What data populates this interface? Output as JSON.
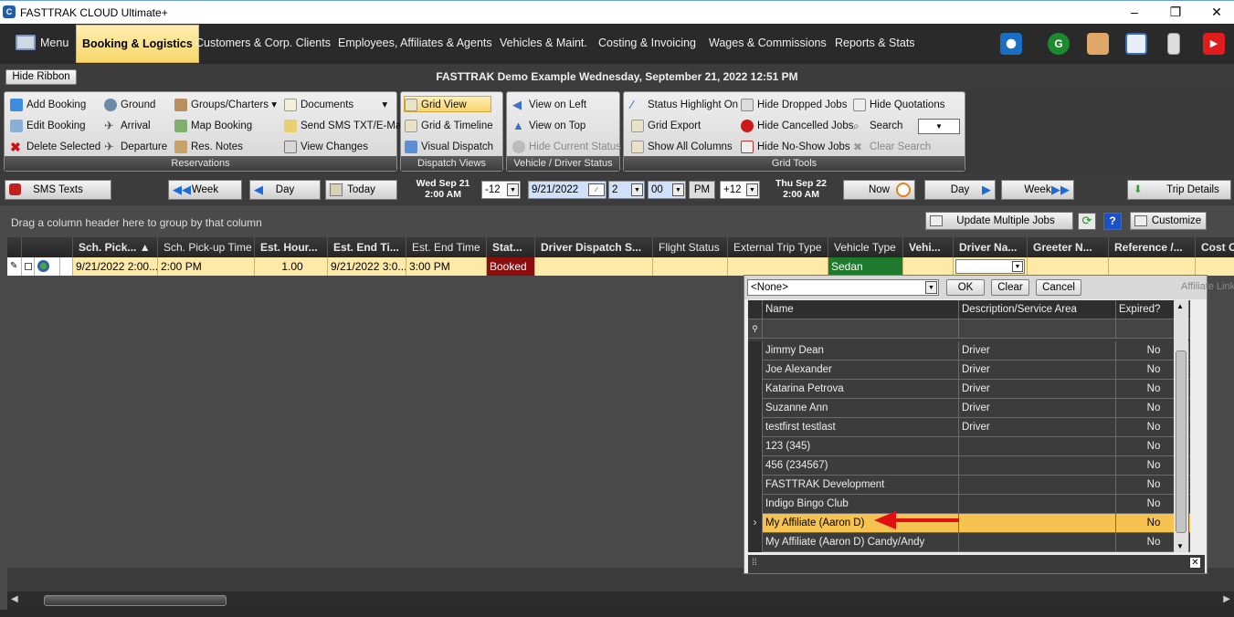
{
  "window": {
    "title": "FASTTRAK CLOUD Ultimate+",
    "minimize": "–",
    "maximize": "❐",
    "close": "✕"
  },
  "menu": {
    "menu_label": "Menu",
    "items": [
      "Booking & Logistics",
      "Customers & Corp. Clients",
      "Employees, Affiliates & Agents",
      "Vehicles & Maint.",
      "Costing & Invoicing",
      "Wages & Commissions",
      "Reports & Stats"
    ]
  },
  "ribbonbar": {
    "hide_ribbon": "Hide Ribbon",
    "title": "FASTTRAK Demo Example  Wednesday, September 21, 2022 12:51 PM"
  },
  "ribbon": {
    "reservations": {
      "label": "Reservations",
      "add": "Add Booking",
      "edit": "Edit Booking",
      "delete": "Delete Selected",
      "ground": "Ground",
      "arrival": "Arrival",
      "departure": "Departure",
      "groups": "Groups/Charters",
      "map": "Map Booking",
      "notes": "Res. Notes",
      "documents": "Documents",
      "sms": "Send SMS TXT/E-Mail",
      "changes": "View Changes"
    },
    "dispatch": {
      "label": "Dispatch Views",
      "grid": "Grid View",
      "timeline": "Grid & Timeline",
      "visual": "Visual Dispatch"
    },
    "status": {
      "label": "Vehicle / Driver Status",
      "left": "View on Left",
      "top": "View on Top",
      "hide": "Hide Current Status"
    },
    "tools": {
      "label": "Grid Tools",
      "highlight": "Status Highlight On",
      "export": "Grid Export",
      "columns": "Show All Columns",
      "dropped": "Hide Dropped Jobs",
      "cancelled": "Hide Cancelled Jobs",
      "noshow": "Hide No-Show Jobs",
      "quotations": "Hide Quotations",
      "search": "Search",
      "clear": "Clear Search"
    }
  },
  "nav": {
    "sms": "SMS Texts",
    "week": "Week",
    "day": "Day",
    "today": "Today",
    "left_date": "Wed Sep 21",
    "left_time": "2:00 AM",
    "minus": "-12",
    "date": "9/21/2022",
    "hour": "2",
    "minute": "00",
    "ampm": "PM",
    "plus": "+12",
    "right_date": "Thu Sep 22",
    "right_time": "2:00 AM",
    "now": "Now",
    "day2": "Day",
    "week2": "Week",
    "trip": "Trip Details"
  },
  "grid": {
    "group_hint": "Drag a column header here to group by that column",
    "update": "Update Multiple Jobs",
    "customize": "Customize",
    "headers": [
      "Sch. Pick...",
      "Sch. Pick-up Time",
      "Est. Hour...",
      "Est. End Ti...",
      "Est. End Time",
      "Stat...",
      "Driver Dispatch S...",
      "Flight Status",
      "External Trip Type",
      "Vehicle Type",
      "Vehi...",
      "Driver Na...",
      "Greeter N...",
      "Reference /...",
      "Cost C"
    ],
    "sort_arrow": "▲",
    "row": {
      "pickup": "9/21/2022 2:00...",
      "pickup_time": "2:00 PM",
      "hours": "1.00",
      "end": "9/21/2022 3:0...",
      "end_time": "3:00 PM",
      "status": "Booked",
      "vehicle_type": "Sedan"
    },
    "status_color": "#8b0e0e",
    "vehicle_color": "#1f7a2e"
  },
  "popup": {
    "selected": "<None>",
    "ok": "OK",
    "clear": "Clear",
    "cancel": "Cancel",
    "side_label": "Affiliate Link",
    "headers": [
      "Name",
      "Description/Service Area",
      "Expired?"
    ],
    "rows": [
      {
        "name": "Jimmy Dean",
        "desc": "Driver",
        "expired": "No"
      },
      {
        "name": "Joe Alexander",
        "desc": "Driver",
        "expired": "No"
      },
      {
        "name": "Katarina Petrova",
        "desc": "Driver",
        "expired": "No"
      },
      {
        "name": "Suzanne Ann",
        "desc": "Driver",
        "expired": "No"
      },
      {
        "name": "testfirst testlast",
        "desc": "Driver",
        "expired": "No"
      },
      {
        "name": "123 (345)",
        "desc": "",
        "expired": "No"
      },
      {
        "name": "456 (234567)",
        "desc": "",
        "expired": "No"
      },
      {
        "name": "FASTTRAK Development",
        "desc": "",
        "expired": "No"
      },
      {
        "name": "Indigo Bingo Club",
        "desc": "",
        "expired": "No"
      },
      {
        "name": "My Affiliate (Aaron D)",
        "desc": "",
        "expired": "No"
      },
      {
        "name": "My Affiliate (Aaron D) Candy/Andy",
        "desc": "",
        "expired": "No"
      }
    ],
    "selected_index": 9
  }
}
